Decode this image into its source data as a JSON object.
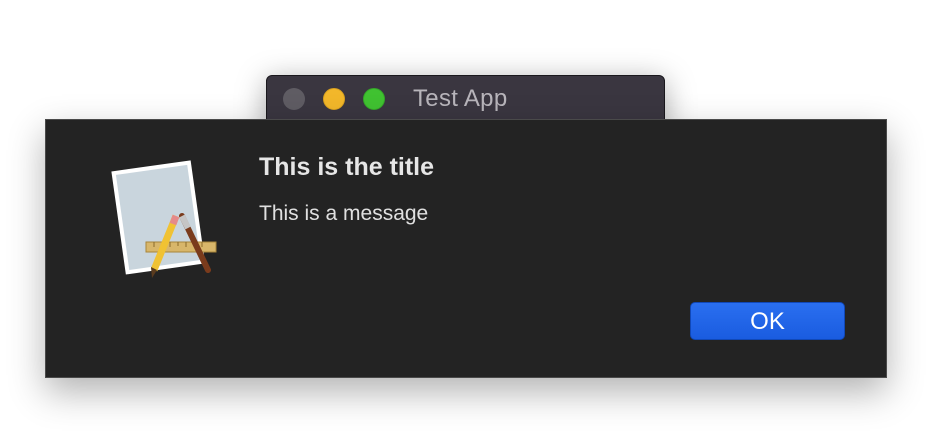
{
  "window": {
    "title": "Test App",
    "controls": {
      "close": "close-button",
      "minimize": "minimize-button",
      "zoom": "zoom-button"
    }
  },
  "alert": {
    "title": "This is the title",
    "message": "This is a message",
    "ok_label": "OK",
    "icon": "app-icon"
  },
  "colors": {
    "sheet_background": "#232323",
    "button_accent": "#1a5ce0",
    "traffic_minimize": "#f2b72a",
    "traffic_zoom": "#40c231",
    "traffic_close_inactive": "#5f5c63"
  }
}
